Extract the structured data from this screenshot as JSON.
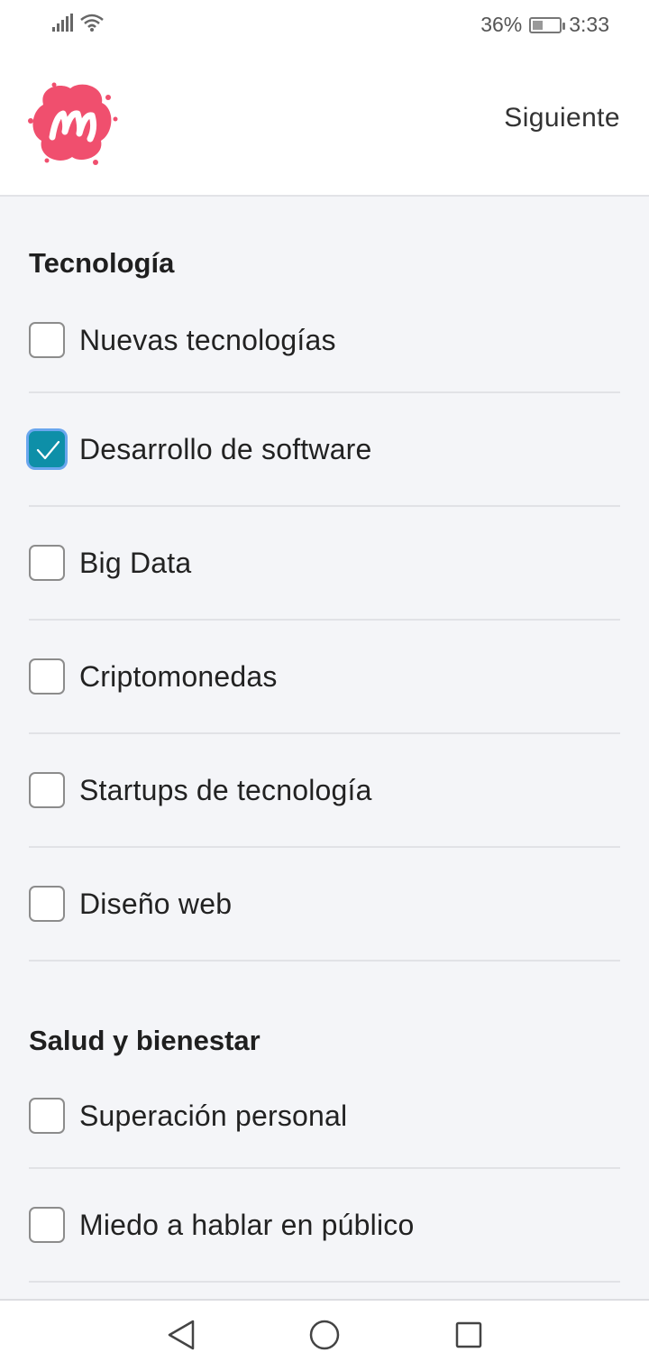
{
  "status": {
    "battery_percent": "36%",
    "battery_level": 0.36,
    "time": "3:33",
    "icons": [
      "signal-icon",
      "wifi-icon",
      "battery-charging-icon"
    ]
  },
  "header": {
    "logo": "meetup-logo",
    "next_label": "Siguiente"
  },
  "sections": [
    {
      "title": "Tecnología",
      "items": [
        {
          "label": "Nuevas tecnologías",
          "checked": false
        },
        {
          "label": "Desarrollo de software",
          "checked": true
        },
        {
          "label": "Big Data",
          "checked": false
        },
        {
          "label": "Criptomonedas",
          "checked": false
        },
        {
          "label": "Startups de tecnología",
          "checked": false
        },
        {
          "label": "Diseño web",
          "checked": false
        }
      ]
    },
    {
      "title": "Salud y bienestar",
      "items": [
        {
          "label": "Superación personal",
          "checked": false
        },
        {
          "label": "Miedo a hablar en público",
          "checked": false
        }
      ]
    }
  ],
  "colors": {
    "brand": "#f04f6e",
    "checked": "#0e8fa8",
    "focus_ring": "#6aa6ee"
  },
  "nav": {
    "icons": [
      "back-triangle-icon",
      "home-circle-icon",
      "recents-square-icon"
    ]
  }
}
